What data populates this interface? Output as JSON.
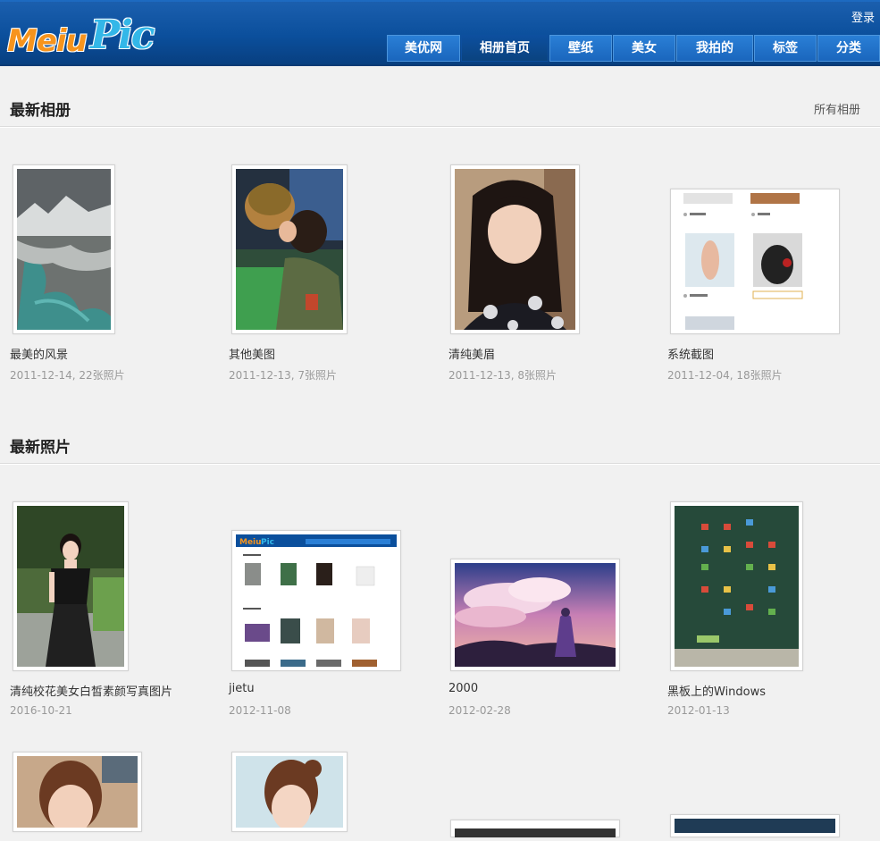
{
  "header": {
    "logo_part1": "Meiu",
    "logo_part2": "Pic",
    "login": "登录",
    "nav": [
      "美优网",
      "相册首页",
      "壁纸",
      "美女",
      "我拍的",
      "标签",
      "分类"
    ]
  },
  "albums": {
    "title": "最新相册",
    "link": "所有相册",
    "items": [
      {
        "name": "最美的风景",
        "meta": "2011-12-14, 22张照片"
      },
      {
        "name": "其他美图",
        "meta": "2011-12-13, 7张照片"
      },
      {
        "name": "清纯美眉",
        "meta": "2011-12-13, 8张照片"
      },
      {
        "name": "系统截图",
        "meta": "2011-12-04, 18张照片"
      }
    ]
  },
  "photos": {
    "title": "最新照片",
    "items": [
      {
        "name": "清纯校花美女白皙素颜写真图片",
        "meta": "2016-10-21"
      },
      {
        "name": "jietu",
        "meta": "2012-11-08"
      },
      {
        "name": "2000",
        "meta": "2012-02-28"
      },
      {
        "name": "黑板上的Windows",
        "meta": "2012-01-13"
      }
    ]
  },
  "colors": {
    "header_blue": "#0b4f9c",
    "nav_blue": "#1a66bd",
    "background": "#f1f1f1"
  }
}
